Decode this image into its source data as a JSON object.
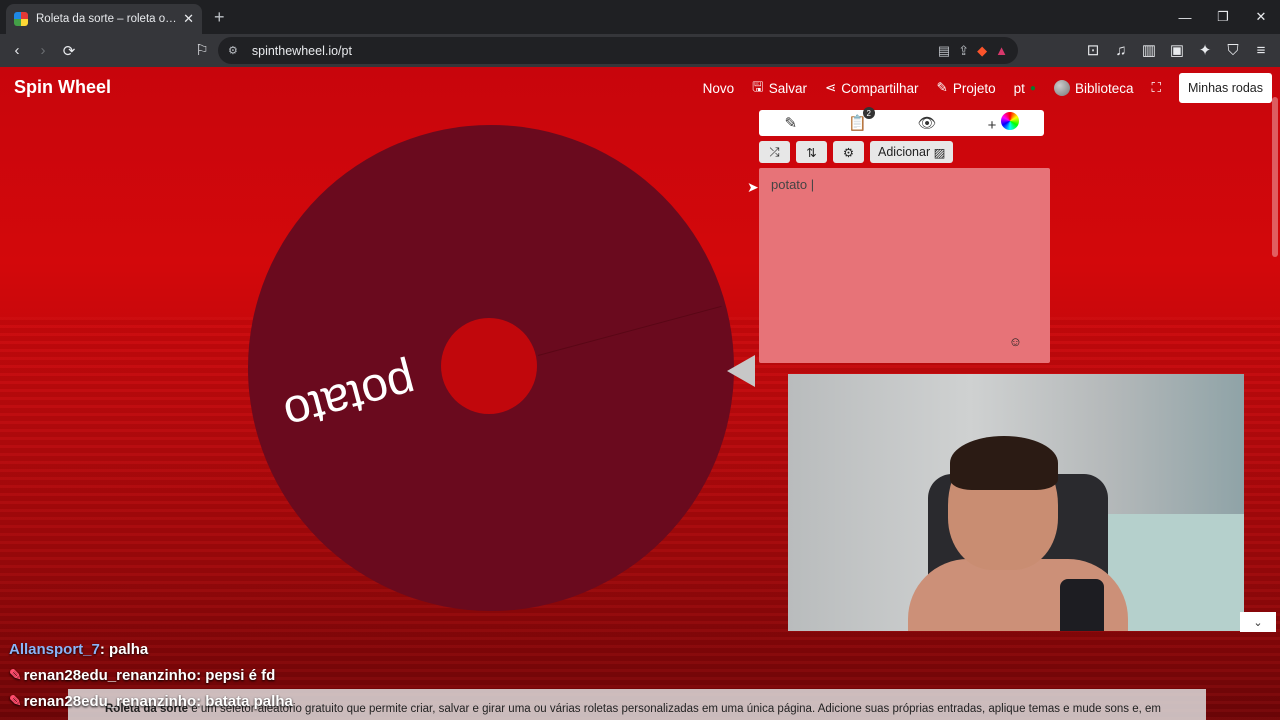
{
  "browser": {
    "tab_title": "Roleta da sorte – roleta online g",
    "url": "spinthewheel.io/pt",
    "new_tab": "+",
    "window_controls": {
      "minimize": "—",
      "maximize": "❐",
      "close": "✕"
    }
  },
  "site": {
    "logo": "Spin Wheel",
    "nav": {
      "novo": "Novo",
      "salvar": "Salvar",
      "compartilhar": "Compartilhar",
      "projeto": "Projeto",
      "lang": "pt",
      "biblioteca": "Biblioteca",
      "minhas_rodas": "Minhas rodas"
    },
    "editor": {
      "tabs": {
        "entries_badge": "2"
      },
      "adicionar_label": "Adicionar",
      "entries_text": "potato |",
      "emoji_icon": "smiley-icon"
    },
    "wheel": {
      "slice_label": "potato",
      "colors": {
        "slice": "#6a0a1e",
        "hub": "#c1070c"
      }
    }
  },
  "chat": [
    {
      "user": "Allansport_7",
      "message": "palha"
    },
    {
      "user": "renan28edu_renanzinho",
      "message": "pepsi é fd"
    },
    {
      "user": "renan28edu_renanzinho",
      "message": "batata palha"
    }
  ],
  "footer": {
    "bold": "Roleta da sorte",
    "text": " é um seletor aleatório gratuito que permite criar, salvar e girar uma ou várias roletas personalizadas em uma única página. Adicione suas próprias entradas, aplique temas e mude sons e, em"
  }
}
